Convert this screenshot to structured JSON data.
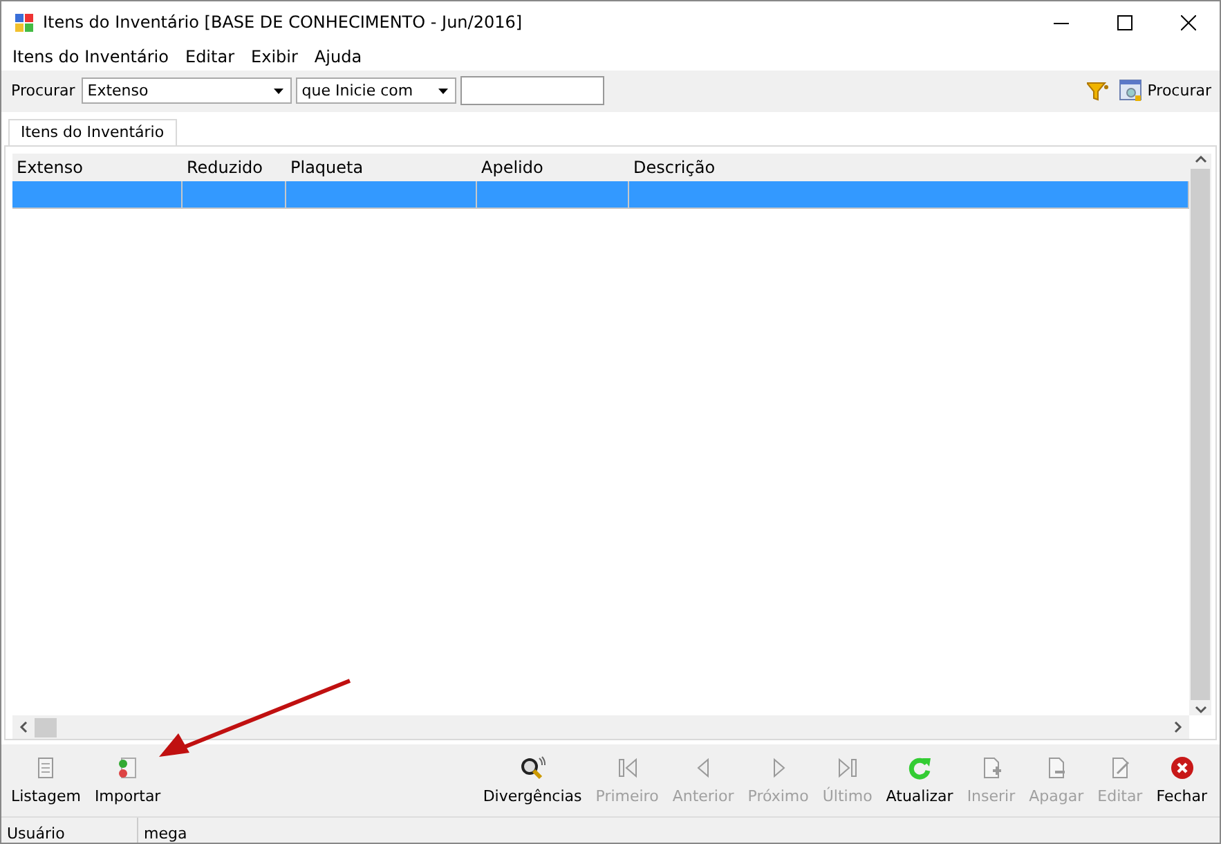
{
  "window": {
    "title": "Itens do Inventário [BASE DE CONHECIMENTO - Jun/2016]"
  },
  "menu": [
    "Itens do Inventário",
    "Editar",
    "Exibir",
    "Ajuda"
  ],
  "search": {
    "label": "Procurar",
    "field_value": "Extenso",
    "mode_value": "que Inicie com",
    "button": "Procurar"
  },
  "tabs": [
    {
      "label": "Itens do Inventário",
      "selected": true
    }
  ],
  "table": {
    "columns": [
      "Extenso",
      "Reduzido",
      "Plaqueta",
      "Apelido",
      "Descrição"
    ],
    "rows": [
      {
        "selected": true
      }
    ]
  },
  "left_buttons": [
    {
      "label": "Listagem",
      "disabled": false
    },
    {
      "label": "Importar",
      "disabled": false
    }
  ],
  "right_buttons": [
    {
      "label": "Divergências",
      "disabled": false
    },
    {
      "label": "Primeiro",
      "disabled": true
    },
    {
      "label": "Anterior",
      "disabled": true
    },
    {
      "label": "Próximo",
      "disabled": true
    },
    {
      "label": "Último",
      "disabled": true
    },
    {
      "label": "Atualizar",
      "disabled": false
    },
    {
      "label": "Inserir",
      "disabled": true
    },
    {
      "label": "Apagar",
      "disabled": true
    },
    {
      "label": "Editar",
      "disabled": true
    },
    {
      "label": "Fechar",
      "disabled": false
    }
  ],
  "status_bar": [
    "Usuário",
    "mega"
  ]
}
